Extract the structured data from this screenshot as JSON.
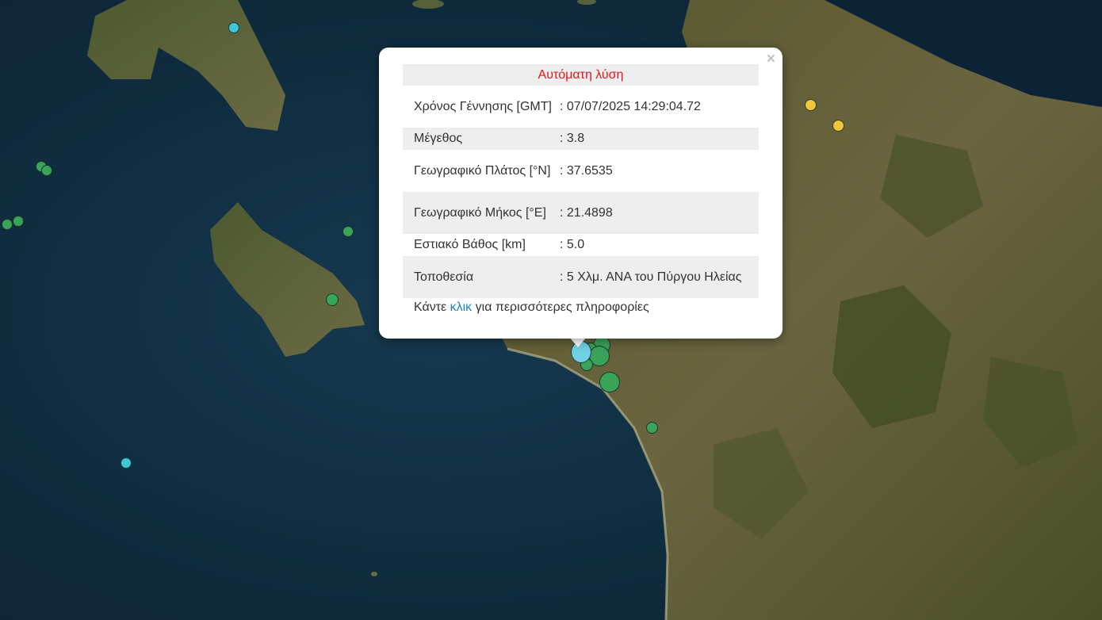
{
  "popup": {
    "title": "Αυτόματη λύση",
    "close_label": "×",
    "rows": [
      {
        "label": "Χρόνος Γέννησης [GMT]",
        "value": ": 07/07/2025 14:29:04.72"
      },
      {
        "label": "Μέγεθος",
        "value": ": 3.8"
      },
      {
        "label": "Γεωγραφικό Πλάτος [°N]",
        "value": ": 37.6535"
      },
      {
        "label": "Γεωγραφικό Μήκος [°E]",
        "value": ": 21.4898"
      },
      {
        "label": "Εστιακό Βάθος [km]",
        "value": ": 5.0"
      },
      {
        "label": "Τοποθεσία",
        "value": ": 5 Χλμ. ΑΝΑ του Πύργου Ηλείας"
      }
    ],
    "more_prefix": "Κάντε ",
    "more_link": "κλικ",
    "more_suffix": " για περισσότερες πληροφορίες"
  },
  "marker_colors": {
    "cyan": "#3cc6d6",
    "green": "#3aa35a",
    "yellow": "#f0c63c",
    "light_blue": "#6fd0e6"
  },
  "map_colors": {
    "sea": "#0f2a3e",
    "land": "#5d5a36"
  }
}
